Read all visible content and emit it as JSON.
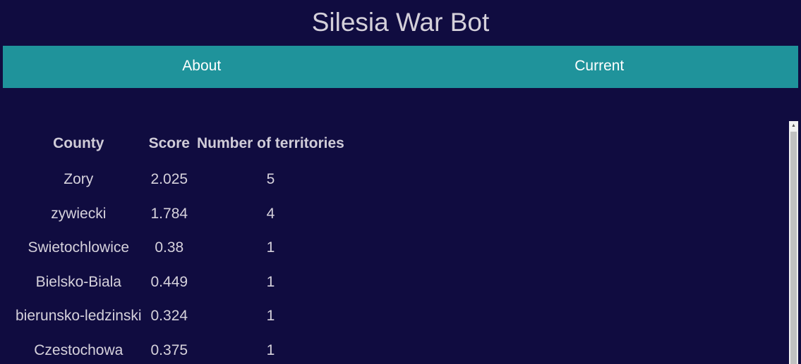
{
  "app": {
    "title": "Silesia War Bot"
  },
  "nav": {
    "items": [
      {
        "label": "About"
      },
      {
        "label": "Current"
      }
    ]
  },
  "table": {
    "headers": [
      "County",
      "Score",
      "Number of territories"
    ],
    "rows": [
      [
        "Zory",
        "2.025",
        "5"
      ],
      [
        "zywiecki",
        "1.784",
        "4"
      ],
      [
        "Swietochlowice",
        "0.38",
        "1"
      ],
      [
        "Bielsko-Biala",
        "0.449",
        "1"
      ],
      [
        "bierunsko-ledzinski",
        "0.324",
        "1"
      ],
      [
        "Czestochowa",
        "0.375",
        "1"
      ]
    ]
  },
  "colors": {
    "background": "#100c40",
    "navbar": "#1f939b",
    "text": "#d6d2dc"
  },
  "icons": {
    "scroll_up": "chevron-up-icon"
  }
}
